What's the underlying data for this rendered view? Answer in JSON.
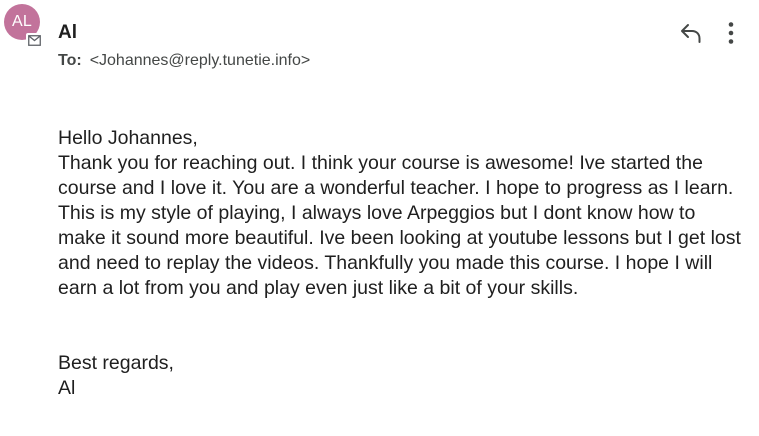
{
  "sender": {
    "avatar_initials": "AL",
    "name": "Al",
    "avatar_color": "#c2739b"
  },
  "recipient": {
    "label": "To:",
    "address": "<Johannes@reply.tunetie.info>"
  },
  "icons": {
    "badge": "mail-badge-icon",
    "reply": "reply-icon",
    "more": "more-vertical-icon"
  },
  "message": {
    "greeting": "Hello Johannes,",
    "body": "Thank you for reaching out. I think your course is awesome! Ive started the course and I love it. You are a wonderful teacher. I hope to progress as I learn. This is my style of playing, I always love Arpeggios but I dont know how to make it sound more beautiful. Ive been looking at youtube lessons but I get lost and need to replay the videos. Thankfully you made this course. I hope I will earn a lot from you and play even just like a bit of your skills.",
    "closing": "Best regards,",
    "signature": "Al"
  }
}
